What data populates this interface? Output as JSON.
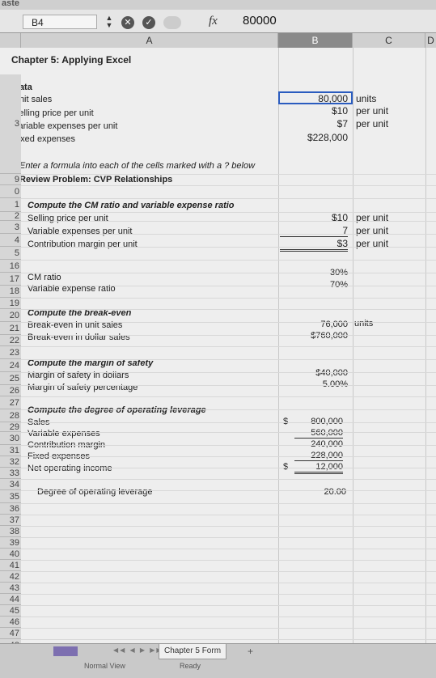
{
  "top_fragment": "aste",
  "formula_bar": {
    "name_box": "B4",
    "fx_label": "fx",
    "formula_value": "80000"
  },
  "columns": [
    "A",
    "B",
    "C",
    "D"
  ],
  "row_numbers": [
    "3",
    "9",
    "0",
    "1",
    "2",
    "3",
    "4",
    "5",
    "16",
    "17",
    "18",
    "19",
    "20",
    "21",
    "22",
    "23",
    "24",
    "25",
    "26",
    "27",
    "28",
    "29",
    "30",
    "31",
    "32",
    "33",
    "34",
    "35",
    "36",
    "37",
    "38",
    "39",
    "40",
    "41",
    "42",
    "43",
    "44",
    "45",
    "46",
    "47",
    "48"
  ],
  "sheet": {
    "title": "Chapter 5: Applying Excel",
    "data_header": "Data",
    "unit_sales_label": "Unit sales",
    "unit_sales_value": "80,000",
    "unit_sales_unit": "units",
    "price_label": "Selling price per unit",
    "price_value": "$10",
    "price_unit": "per unit",
    "varexp_label": "Variable expenses per unit",
    "varexp_value": "$7",
    "varexp_unit": "per unit",
    "fixed_label": "Fixed expenses",
    "fixed_value": "$228,000",
    "instruction": "Enter a formula into each of the cells marked with a ? below",
    "review_title": "Review Problem: CVP Relationships",
    "cm_header": "Compute the CM ratio and variable expense ratio",
    "cm_price_label": "Selling price per unit",
    "cm_price_value": "$10",
    "cm_price_unit": "per unit",
    "cm_var_label": "Variable expenses per unit",
    "cm_var_value": "7",
    "cm_var_unit": "per unit",
    "cm_margin_label": "Contribution margin per unit",
    "cm_margin_value": "$3",
    "cm_margin_unit": "per unit",
    "cm_ratio_label": "CM ratio",
    "cm_ratio_value": "30%",
    "ve_ratio_label": "Variable expense ratio",
    "ve_ratio_value": "70%",
    "be_header": "Compute the break-even",
    "be_units_label": "Break-even in unit sales",
    "be_units_value": "76,000",
    "be_units_unit": "units",
    "be_dollars_label": "Break-even in dollar sales",
    "be_dollars_value": "$760,000",
    "ms_header": "Compute the margin of safety",
    "ms_dollars_label": "Margin of safety in dollars",
    "ms_dollars_value": "$40,000",
    "ms_pct_label": "Margin of safety percentage",
    "ms_pct_value": "5.00%",
    "dol_header": "Compute the degree of operating leverage",
    "sales_label": "Sales",
    "sales_dollar": "$",
    "sales_value": "800,000",
    "var_label": "Variable expenses",
    "var_value": "560,000",
    "contrib_label": "Contribution margin",
    "contrib_value": "240,000",
    "fixed2_label": "Fixed expenses",
    "fixed2_value": "228,000",
    "noi_label": "Net operating income",
    "noi_dollar": "$",
    "noi_value": "12,000",
    "dol_label": "Degree of operating leverage",
    "dol_value": "20.00"
  },
  "bottom_bar": {
    "sheet_tab": "Chapter 5 Form",
    "status_view": "Normal View",
    "status_ready": "Ready"
  }
}
